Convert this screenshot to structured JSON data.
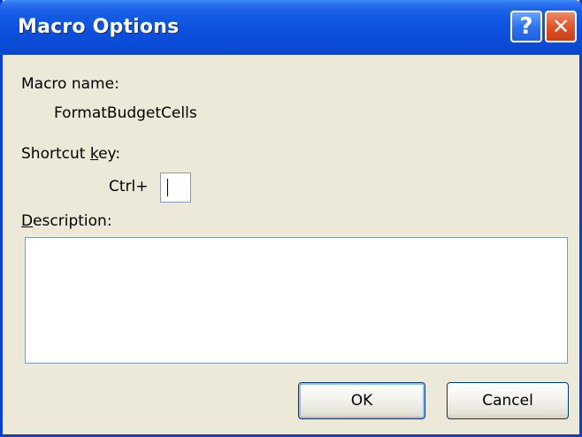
{
  "window": {
    "title": "Macro Options",
    "help_glyph": "?",
    "close_glyph": "✕"
  },
  "macro": {
    "name_label": "Macro name:",
    "name_value": "FormatBudgetCells"
  },
  "shortcut": {
    "label_pre": "Shortcut ",
    "label_accel": "k",
    "label_post": "ey:",
    "ctrl_prefix": "Ctrl+",
    "value": ""
  },
  "description": {
    "label_accel": "D",
    "label_post": "escription:",
    "value": ""
  },
  "buttons": {
    "ok_label": "OK",
    "cancel_label": "Cancel"
  },
  "colors": {
    "titlebar": "#0a46cc",
    "dialog_bg": "#ece9d8",
    "close_button": "#e0552c",
    "help_button": "#2e74f2"
  }
}
